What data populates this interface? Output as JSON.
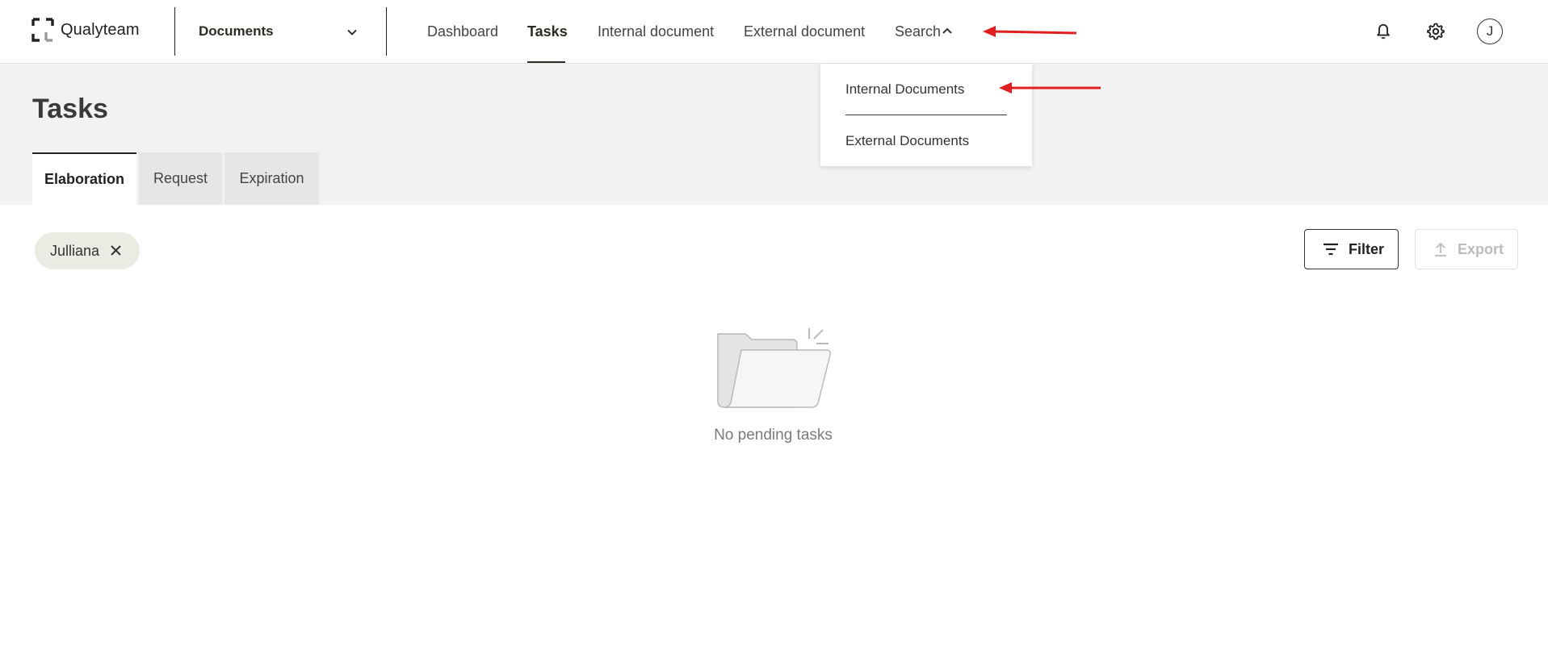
{
  "app": {
    "brand": "Qualyteam",
    "module": "Documents"
  },
  "nav": {
    "items": [
      "Dashboard",
      "Tasks",
      "Internal document",
      "External document",
      "Search"
    ],
    "active": "Tasks"
  },
  "search_menu": {
    "items": [
      "Internal Documents",
      "External Documents"
    ]
  },
  "user": {
    "avatar_initial": "J"
  },
  "page": {
    "title": "Tasks",
    "tabs": [
      "Elaboration",
      "Request",
      "Expiration"
    ],
    "active_tab": "Elaboration"
  },
  "filters": {
    "chip_label": "Julliana"
  },
  "toolbar": {
    "filter_label": "Filter",
    "export_label": "Export"
  },
  "empty_state": {
    "message": "No pending tasks"
  },
  "colors": {
    "accent_dark": "#2c2c22",
    "annotation_arrow": "#e02020",
    "header_bg": "#f2f2f2",
    "chip_bg": "#ebebe4"
  },
  "icons": {
    "notifications": "bell-icon",
    "settings": "gear-icon",
    "module_toggle": "chevron-down-icon",
    "search_toggle": "chevron-up-icon",
    "chip_remove": "close-icon",
    "filter": "filter-icon",
    "export": "upload-icon",
    "empty": "empty-folder-icon"
  }
}
